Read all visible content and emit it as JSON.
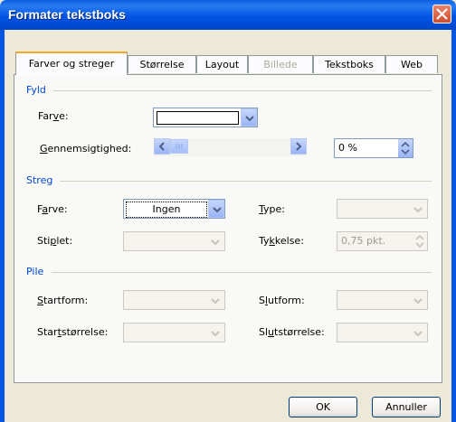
{
  "window": {
    "title": "Formater tekstboks"
  },
  "tabs": [
    {
      "label": "Farver og streger",
      "active": true,
      "enabled": true
    },
    {
      "label": "Størrelse",
      "active": false,
      "enabled": true
    },
    {
      "label": "Layout",
      "active": false,
      "enabled": true
    },
    {
      "label": "Billede",
      "active": false,
      "enabled": false
    },
    {
      "label": "Tekstboks",
      "active": false,
      "enabled": true
    },
    {
      "label": "Web",
      "active": false,
      "enabled": true
    }
  ],
  "fill": {
    "heading": "Fyld",
    "color_label_pre": "Far",
    "color_label_acc": "v",
    "color_label_post": "e:",
    "color_value": "",
    "transparency_label_acc": "G",
    "transparency_label_post": "ennemsigtighed:",
    "transparency_value": "0 %",
    "transparency_fraction": 0
  },
  "line": {
    "heading": "Streg",
    "color_label_pre": "F",
    "color_label_acc": "a",
    "color_label_post": "rve:",
    "color_value": "Ingen",
    "type_label_acc": "T",
    "type_label_post": "ype:",
    "dash_label_pre": "Sti",
    "dash_label_acc": "p",
    "dash_label_post": "let:",
    "weight_label_pre": "Ty",
    "weight_label_acc": "k",
    "weight_label_post": "kelse:",
    "weight_value": "0,75 pkt."
  },
  "arrows": {
    "heading": "Pile",
    "begin_style_label_acc": "S",
    "begin_style_label_post": "tartform:",
    "begin_size_label_pre": "Star",
    "begin_size_label_acc": "t",
    "begin_size_label_post": "størrelse:",
    "end_style_label_pre": "S",
    "end_style_label_acc": "l",
    "end_style_label_post": "utform:",
    "end_size_label_pre": "Sl",
    "end_size_label_acc": "u",
    "end_size_label_post": "tstørrelse:"
  },
  "buttons": {
    "ok": "OK",
    "cancel": "Annuller"
  },
  "colors": {
    "titlebar": "#0055e5",
    "section_heading": "#0046d5",
    "tab_highlight": "#f5a623"
  }
}
